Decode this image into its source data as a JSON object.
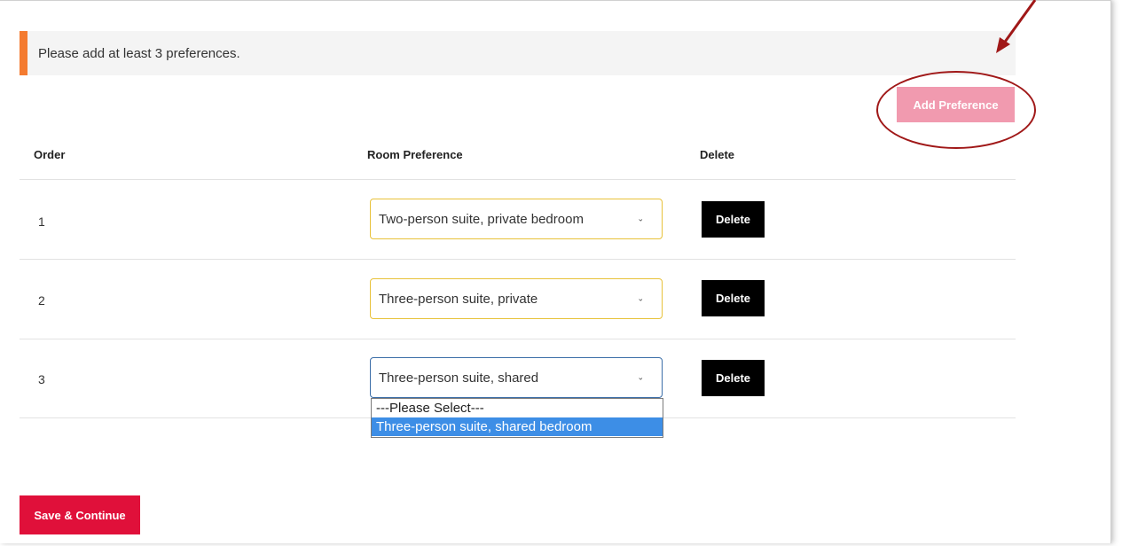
{
  "notice": {
    "text": "Please add at least 3 preferences.",
    "accent_color": "#f47b30"
  },
  "add_button": {
    "label": "Add Preference",
    "color": "#f19aaf"
  },
  "table": {
    "headers": {
      "order": "Order",
      "room_preference": "Room Preference",
      "delete": "Delete"
    },
    "rows": [
      {
        "order": "1",
        "selected": "Two-person suite, private bedroom",
        "delete_label": "Delete"
      },
      {
        "order": "2",
        "selected": "Three-person suite, private",
        "delete_label": "Delete"
      },
      {
        "order": "3",
        "selected": "Three-person suite, shared",
        "delete_label": "Delete"
      }
    ]
  },
  "open_dropdown": {
    "options": [
      "---Please Select---",
      "Three-person suite, shared bedroom"
    ],
    "highlighted_index": 1
  },
  "save_button": {
    "label": "Save & Continue",
    "color": "#e0103a"
  },
  "annotation_color": "#a01818"
}
